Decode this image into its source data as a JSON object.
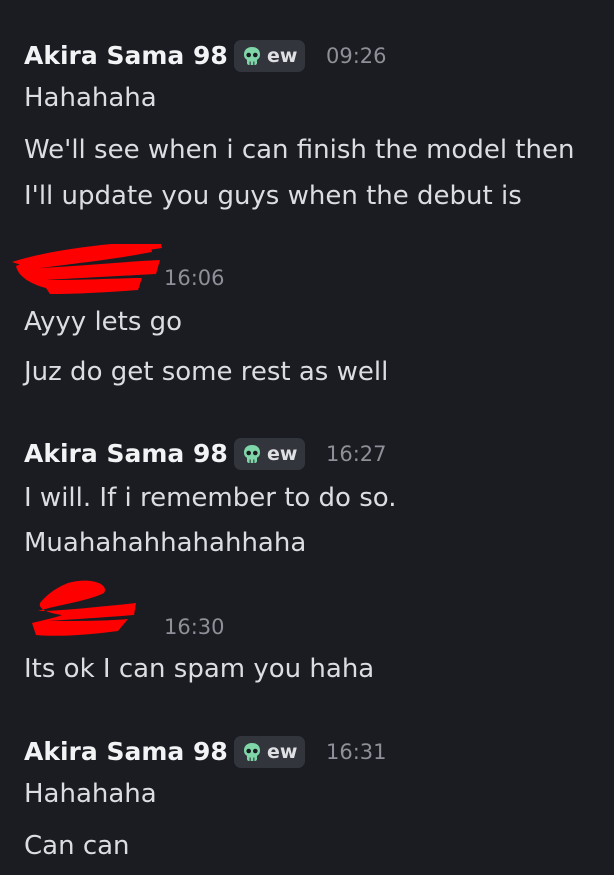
{
  "messages": [
    {
      "author": "Akira Sama 98",
      "tag": {
        "icon": "skull-icon",
        "label": "ew"
      },
      "time": "09:26",
      "lines": [
        "Hahahaha",
        "We'll see when i can finish the model then",
        "I'll update you guys when the debut is"
      ]
    },
    {
      "author": "",
      "author_redacted": true,
      "time": "16:06",
      "lines": [
        "Ayyy lets go",
        "Juz do get some rest as well"
      ]
    },
    {
      "author": "Akira Sama 98",
      "tag": {
        "icon": "skull-icon",
        "label": "ew"
      },
      "time": "16:27",
      "lines": [
        "I will. If i remember to do so.",
        "Muahahahhahahhaha"
      ]
    },
    {
      "author": "",
      "author_redacted": true,
      "time": "16:30",
      "lines": [
        "Its ok I can spam you haha"
      ]
    },
    {
      "author": "Akira Sama 98",
      "tag": {
        "icon": "skull-icon",
        "label": "ew"
      },
      "time": "16:31",
      "lines": [
        "Hahahaha",
        "Can can"
      ]
    }
  ],
  "colors": {
    "background": "#1b1c21",
    "author": "#f2f3f5",
    "text": "#dcdde1",
    "timestamp": "#8d9098",
    "tag_bg": "#33353c",
    "skull": "#7fd6a8",
    "redaction": "#ff0000"
  }
}
